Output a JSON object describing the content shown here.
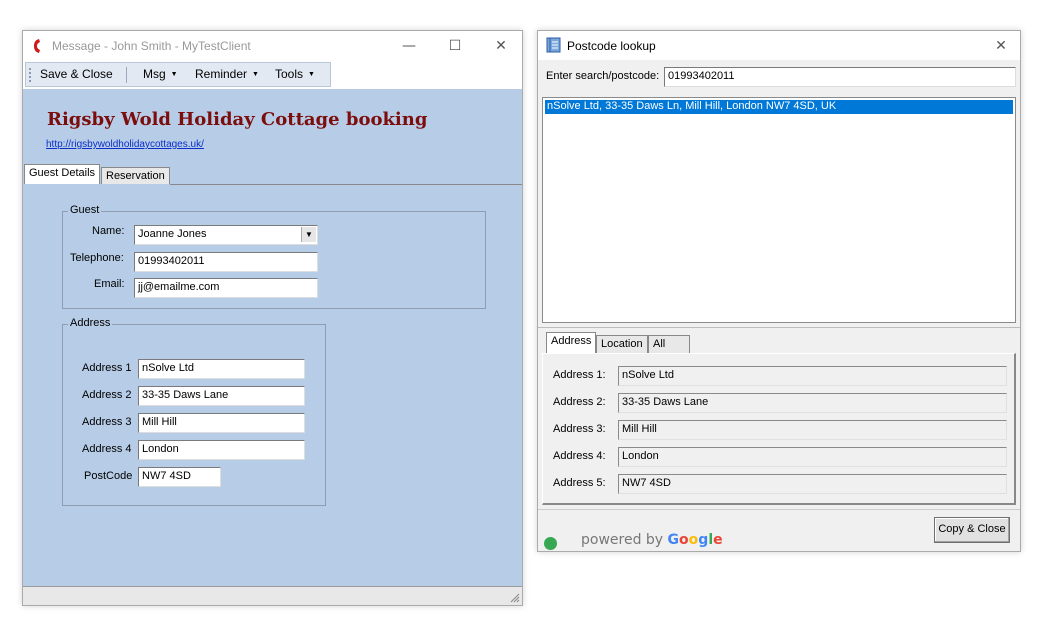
{
  "message_window": {
    "title": "Message - John Smith  -  MyTestClient",
    "caption_buttons": {
      "minimize": "—",
      "maximize": "☐",
      "close": "✕"
    },
    "toolbar": {
      "save_close": "Save & Close",
      "msg": "Msg",
      "reminder": "Reminder",
      "tools": "Tools"
    },
    "heading": "Rigsby Wold Holiday Cottage booking",
    "link": "http://rigsbywoldholidaycottages.uk/",
    "tabs": [
      {
        "label": "Guest Details",
        "active": true
      },
      {
        "label": "Reservation",
        "active": false
      }
    ],
    "guest": {
      "group_label": "Guest",
      "name_label": "Name:",
      "name_value": "Joanne Jones",
      "telephone_label": "Telephone:",
      "telephone_value": "01993402011",
      "email_label": "Email:",
      "email_value": "jj@emailme.com"
    },
    "address": {
      "group_label": "Address",
      "fields": [
        {
          "label": "Address 1",
          "value": "nSolve Ltd"
        },
        {
          "label": "Address 2",
          "value": "33-35 Daws Lane"
        },
        {
          "label": "Address 3",
          "value": "Mill Hill"
        },
        {
          "label": "Address 4",
          "value": "London"
        },
        {
          "label": "PostCode",
          "value": "NW7 4SD"
        }
      ]
    }
  },
  "postcode_window": {
    "title": "Postcode lookup",
    "close": "✕",
    "search_label": "Enter search/postcode:",
    "search_value": "01993402011",
    "results": [
      {
        "text": "nSolve Ltd, 33-35 Daws Ln, Mill Hill, London NW7 4SD, UK",
        "selected": true
      }
    ],
    "tabs": [
      {
        "label": "Address",
        "active": true
      },
      {
        "label": "Location",
        "active": false
      },
      {
        "label": "All",
        "active": false
      }
    ],
    "address_fields": [
      {
        "label": "Address 1:",
        "value": "nSolve Ltd"
      },
      {
        "label": "Address 2:",
        "value": "33-35 Daws Lane"
      },
      {
        "label": "Address 3:",
        "value": "Mill Hill"
      },
      {
        "label": "Address 4:",
        "value": "London"
      },
      {
        "label": "Address 5:",
        "value": "NW7 4SD"
      }
    ],
    "copy_close_label": "Copy & Close",
    "powered_by": "powered by",
    "google_letters": [
      {
        "ch": "G",
        "color": "#4285F4"
      },
      {
        "ch": "o",
        "color": "#EA4335"
      },
      {
        "ch": "o",
        "color": "#FBBC05"
      },
      {
        "ch": "g",
        "color": "#4285F4"
      },
      {
        "ch": "l",
        "color": "#34A853"
      },
      {
        "ch": "e",
        "color": "#EA4335"
      }
    ]
  },
  "colors": {
    "client_background": "#b7cde7",
    "heading": "#7b0d0d",
    "link": "#0b2ec8",
    "selection": "#0078d7"
  }
}
